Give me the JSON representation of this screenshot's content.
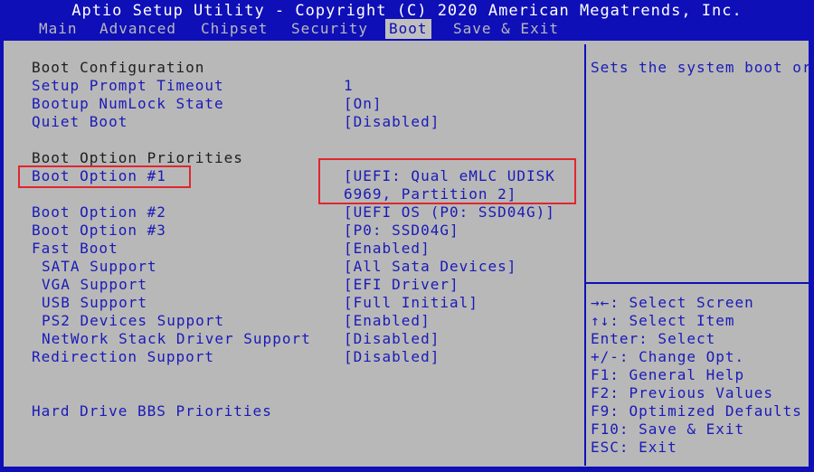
{
  "header": {
    "title": "Aptio Setup Utility - Copyright (C) 2020 American Megatrends, Inc.",
    "tabs": [
      {
        "label": "Main"
      },
      {
        "label": "Advanced"
      },
      {
        "label": "Chipset"
      },
      {
        "label": "Security"
      },
      {
        "label": "Boot"
      },
      {
        "label": "Save & Exit"
      }
    ],
    "active_tab": "Boot"
  },
  "settings": {
    "boot_configuration_heading": "Boot Configuration",
    "setup_prompt_timeout": {
      "label": "Setup Prompt Timeout",
      "value": "1"
    },
    "bootup_numlock_state": {
      "label": "Bootup NumLock State",
      "value": "[On]"
    },
    "quiet_boot": {
      "label": "Quiet Boot",
      "value": "[Disabled]"
    },
    "boot_option_priorities_heading": "Boot Option Priorities",
    "boot_option_1": {
      "label": "Boot Option #1",
      "value_line1": "[UEFI: Qual eMLC UDISK",
      "value_line2": "6969, Partition 2]"
    },
    "boot_option_2": {
      "label": "Boot Option #2",
      "value": "[UEFI OS (P0: SSD04G)]"
    },
    "boot_option_3": {
      "label": "Boot Option #3",
      "value": "[P0: SSD04G]"
    },
    "fast_boot": {
      "label": "Fast Boot",
      "value": "[Enabled]"
    },
    "sata_support": {
      "label": "SATA Support",
      "value": "[All Sata Devices]"
    },
    "vga_support": {
      "label": "VGA Support",
      "value": "[EFI Driver]"
    },
    "usb_support": {
      "label": "USB Support",
      "value": "[Full Initial]"
    },
    "ps2_devices_support": {
      "label": "PS2 Devices Support",
      "value": "[Enabled]"
    },
    "network_stack_driver_support": {
      "label": "NetWork Stack Driver Support",
      "value": "[Disabled]"
    },
    "redirection_support": {
      "label": "Redirection Support",
      "value": "[Disabled]"
    },
    "hard_drive_bbs_priorities": {
      "label": "Hard Drive BBS Priorities"
    }
  },
  "help_panel": {
    "description": "Sets the system boot or",
    "keys": [
      "→←: Select Screen",
      "↑↓: Select Item",
      "Enter: Select",
      "+/-: Change Opt.",
      "F1: General Help",
      "F2: Previous Values",
      "F9: Optimized Defaults",
      "F10: Save & Exit",
      "ESC: Exit"
    ]
  },
  "colors": {
    "bios_blue": "#0f0fb8",
    "panel_gray": "#b8b8b8",
    "highlight_red": "#e0262f"
  }
}
